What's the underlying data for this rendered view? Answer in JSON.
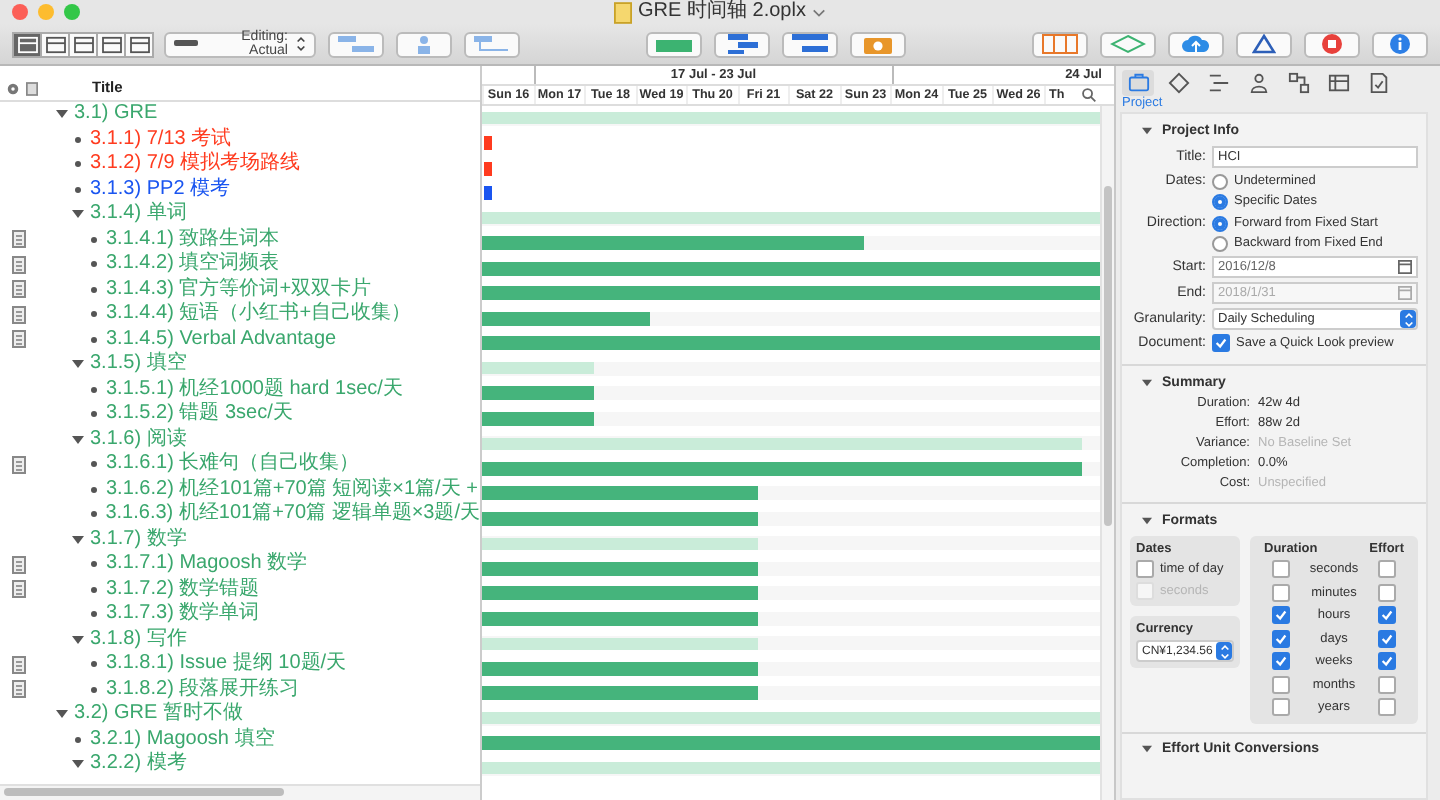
{
  "window": {
    "title": "GRE 时间轴 2.oplx"
  },
  "toolbar": {
    "view_modes": [
      {
        "selected": true
      },
      {
        "selected": false
      },
      {
        "selected": false
      },
      {
        "selected": false
      },
      {
        "selected": false
      }
    ],
    "editing": "Editing: Actual"
  },
  "outline": {
    "column": "Title",
    "rows": [
      {
        "number": "3.1)",
        "title": "GRE",
        "kind": "group",
        "color": "#3aa76d",
        "note": false,
        "expanded": true,
        "level": 1,
        "children": [
          {
            "number": "3.1.1)",
            "title": "7/13 考试",
            "kind": "milestone",
            "color": "#ff3b1f",
            "note": false
          },
          {
            "number": "3.1.2)",
            "title": "7/9 模拟考场路线",
            "kind": "milestone",
            "color": "#ff3b1f",
            "note": false
          },
          {
            "number": "3.1.3)",
            "title": "PP2 模考",
            "kind": "milestone",
            "color": "#1a55f0",
            "note": false
          },
          {
            "number": "3.1.4)",
            "title": "单词",
            "kind": "group",
            "color": "#3aa76d",
            "note": false,
            "expanded": true,
            "level": 1,
            "children": [
              {
                "number": "3.1.4.1)",
                "title": "致路生词本",
                "kind": "task",
                "color": "#3aa76d",
                "note": true,
                "level": 0.615
              },
              {
                "number": "3.1.4.2)",
                "title": "填空词频表",
                "kind": "task",
                "color": "#3aa76d",
                "note": true,
                "level": 1
              },
              {
                "number": "3.1.4.3)",
                "title": "官方等价词+双双卡片",
                "kind": "task",
                "color": "#3aa76d",
                "note": true,
                "level": 1
              },
              {
                "number": "3.1.4.4)",
                "title": "短语（小红书+自己收集）",
                "kind": "task",
                "color": "#3aa76d",
                "note": true,
                "level": 0.27
              },
              {
                "number": "3.1.4.5)",
                "title": "Verbal Advantage",
                "kind": "task",
                "color": "#3aa76d",
                "note": true,
                "level": 1
              }
            ]
          },
          {
            "number": "3.1.5)",
            "title": "填空",
            "kind": "group",
            "color": "#3aa76d",
            "note": false,
            "expanded": true,
            "level": 0.18,
            "children": [
              {
                "number": "3.1.5.1)",
                "title": "机经1000题 hard 1sec/天",
                "kind": "task",
                "color": "#3aa76d",
                "note": false,
                "level": 0.18
              },
              {
                "number": "3.1.5.2)",
                "title": "错题 3sec/天",
                "kind": "task",
                "color": "#3aa76d",
                "note": false,
                "level": 0.18
              }
            ]
          },
          {
            "number": "3.1.6)",
            "title": "阅读",
            "kind": "group",
            "color": "#3aa76d",
            "note": false,
            "expanded": true,
            "level": 0.967,
            "children": [
              {
                "number": "3.1.6.1)",
                "title": "长难句（自己收集）",
                "kind": "task",
                "color": "#3aa76d",
                "note": true,
                "level": 0.967
              },
              {
                "number": "3.1.6.2)",
                "title": "机经101篇+70篇 短阅读×1篇/天 +",
                "kind": "task",
                "color": "#3aa76d",
                "note": false,
                "level": 0.444
              },
              {
                "number": "3.1.6.3)",
                "title": "机经101篇+70篇 逻辑单题×3题/天",
                "kind": "task",
                "color": "#3aa76d",
                "note": false,
                "level": 0.444
              }
            ]
          },
          {
            "number": "3.1.7)",
            "title": "数学",
            "kind": "group",
            "color": "#3aa76d",
            "note": false,
            "expanded": true,
            "level": 0.444,
            "children": [
              {
                "number": "3.1.7.1)",
                "title": "Magoosh 数学",
                "kind": "task",
                "color": "#3aa76d",
                "note": true,
                "level": 0.444
              },
              {
                "number": "3.1.7.2)",
                "title": "数学错题",
                "kind": "task",
                "color": "#3aa76d",
                "note": true,
                "level": 0.444
              },
              {
                "number": "3.1.7.3)",
                "title": "数学单词",
                "kind": "task",
                "color": "#3aa76d",
                "note": false,
                "level": 0.444
              }
            ]
          },
          {
            "number": "3.1.8)",
            "title": "写作",
            "kind": "group",
            "color": "#3aa76d",
            "note": false,
            "expanded": true,
            "level": 0.444,
            "children": [
              {
                "number": "3.1.8.1)",
                "title": "Issue 提纲 10题/天",
                "kind": "task",
                "color": "#3aa76d",
                "note": true,
                "level": 0.444
              },
              {
                "number": "3.1.8.2)",
                "title": "段落展开练习",
                "kind": "task",
                "color": "#3aa76d",
                "note": true,
                "level": 0.444
              }
            ]
          }
        ]
      },
      {
        "number": "3.2)",
        "title": "GRE 暂时不做",
        "kind": "group",
        "color": "#3aa76d",
        "note": false,
        "expanded": true,
        "level": 1,
        "children": [
          {
            "number": "3.2.1)",
            "title": "Magoosh 填空",
            "kind": "task",
            "color": "#3aa76d",
            "note": false,
            "level": 1
          },
          {
            "number": "3.2.2)",
            "title": "模考",
            "kind": "group",
            "color": "#3aa76d",
            "note": false,
            "expanded": true,
            "level": 1
          }
        ]
      }
    ]
  },
  "gantt": {
    "weeks": [
      "17 Jul - 23 Jul",
      "24 Jul"
    ],
    "days": [
      "Sun 16",
      "Mon 17",
      "Tue 18",
      "Wed 19",
      "Thu 20",
      "Fri 21",
      "Sat 22",
      "Sun 23",
      "Mon 24",
      "Tue 25",
      "Wed 26",
      "Th"
    ]
  },
  "inspector": {
    "tabs": [
      {
        "selected": true
      },
      {
        "selected": false
      },
      {
        "selected": false
      },
      {
        "selected": false
      },
      {
        "selected": false
      },
      {
        "selected": false
      },
      {
        "selected": false
      }
    ],
    "tab_label": "Project",
    "project_info": {
      "heading": "Project Info",
      "expanded": true,
      "title_label": "Title:",
      "title": "HCI",
      "dates_label": "Dates:",
      "dates": [
        {
          "label": "Undetermined",
          "selected": false
        },
        {
          "label": "Specific Dates",
          "selected": true
        }
      ],
      "direction_label": "Direction:",
      "direction": [
        {
          "label": "Forward from Fixed Start",
          "selected": true
        },
        {
          "label": "Backward from Fixed End",
          "selected": false
        }
      ],
      "start_label": "Start:",
      "start": "2016/12/8",
      "end_label": "End:",
      "end": "2018/1/31",
      "end_disabled": true,
      "granularity_label": "Granularity:",
      "granularity": "Daily Scheduling",
      "document_label": "Document:",
      "document_option": {
        "label": "Save a Quick Look preview",
        "checked": true
      }
    },
    "summary": {
      "heading": "Summary",
      "expanded": true,
      "rows": [
        {
          "label": "Duration:",
          "value": "42w 4d",
          "muted": false
        },
        {
          "label": "Effort:",
          "value": "88w 2d",
          "muted": false
        },
        {
          "label": "Variance:",
          "value": "No Baseline Set",
          "muted": true
        },
        {
          "label": "Completion:",
          "value": "0.0%",
          "muted": false
        },
        {
          "label": "Cost:",
          "value": "Unspecified",
          "muted": true
        }
      ]
    },
    "formats": {
      "heading": "Formats",
      "expanded": true,
      "dates_title": "Dates",
      "date_options": [
        {
          "label": "time of day",
          "checked": false,
          "disabled": false
        },
        {
          "label": "seconds",
          "checked": false,
          "disabled": true
        }
      ],
      "currency_title": "Currency",
      "currency": "CN¥1,234.56",
      "duration_title": "Duration",
      "effort_title": "Effort",
      "units": [
        {
          "label": "seconds",
          "duration": false,
          "effort": false
        },
        {
          "label": "minutes",
          "duration": false,
          "effort": false
        },
        {
          "label": "hours",
          "duration": true,
          "effort": true
        },
        {
          "label": "days",
          "duration": true,
          "effort": true
        },
        {
          "label": "weeks",
          "duration": true,
          "effort": true
        },
        {
          "label": "months",
          "duration": false,
          "effort": false
        },
        {
          "label": "years",
          "duration": false,
          "effort": false
        }
      ]
    },
    "effort_conversions": {
      "heading": "Effort Unit Conversions",
      "expanded": true
    }
  }
}
